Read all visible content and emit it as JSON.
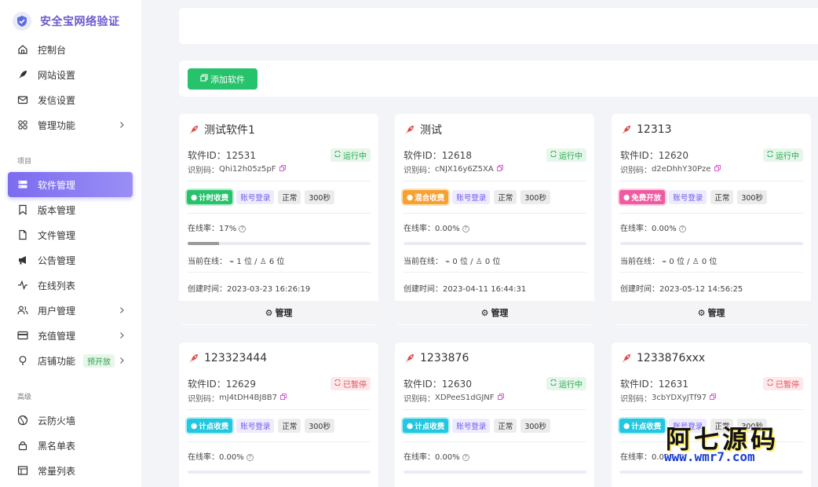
{
  "app": {
    "title": "安全宝网络验证"
  },
  "sidebar": {
    "items_top": [
      {
        "label": "控制台",
        "icon": "home-icon"
      },
      {
        "label": "网站设置",
        "icon": "rocket-icon"
      },
      {
        "label": "发信设置",
        "icon": "mail-icon"
      },
      {
        "label": "管理功能",
        "icon": "apps-icon"
      }
    ],
    "section_project": "项目",
    "items_project": [
      {
        "label": "软件管理",
        "icon": "server-icon"
      },
      {
        "label": "版本管理",
        "icon": "bookmark-icon"
      },
      {
        "label": "文件管理",
        "icon": "file-icon"
      },
      {
        "label": "公告管理",
        "icon": "megaphone-icon"
      },
      {
        "label": "在线列表",
        "icon": "activity-icon"
      },
      {
        "label": "用户管理",
        "icon": "users-icon"
      },
      {
        "label": "充值管理",
        "icon": "card-icon"
      },
      {
        "label": "店铺功能",
        "icon": "pin-icon",
        "badge": "预开放"
      }
    ],
    "section_advanced": "高级",
    "items_advanced": [
      {
        "label": "云防火墙",
        "icon": "globe-icon"
      },
      {
        "label": "黑名单表",
        "icon": "lock-icon"
      },
      {
        "label": "常量列表",
        "icon": "table-icon"
      }
    ]
  },
  "toolbar": {
    "add_label": "添加软件"
  },
  "labels": {
    "id_prefix": "软件ID：",
    "code_prefix": "识别码：",
    "online_rate_prefix": "在线率：",
    "current_prefix": "当前在线：",
    "created_prefix": "创建时间：",
    "manage": "管理",
    "login": "账号登录",
    "normal": "正常",
    "duration": "300秒",
    "running": "运行中",
    "paused": "已暂停"
  },
  "cards": [
    {
      "name": "测试软件1",
      "id": "12531",
      "code": "Qhi12h05z5pF",
      "status": "running",
      "type_label": "计时收费",
      "type": "time",
      "rate": "17%",
      "rate_value": 0.17,
      "online": "1 位 /",
      "total": "6 位",
      "created": "2023-03-23 16:26:19"
    },
    {
      "name": "测试",
      "id": "12618",
      "code": "cNJX16y6Z5XA",
      "status": "running",
      "type_label": "混合收费",
      "type": "mixed",
      "rate": "0.00%",
      "rate_value": 0,
      "online": "0 位 /",
      "total": "0 位",
      "created": "2023-04-11 16:44:31"
    },
    {
      "name": "12313",
      "id": "12620",
      "code": "d2eDhhY30Pze",
      "status": "running",
      "type_label": "免费开放",
      "type": "free",
      "rate": "0.00%",
      "rate_value": 0,
      "online": "0 位 /",
      "total": "0 位",
      "created": "2023-05-12 14:56:25"
    },
    {
      "name": "123323444",
      "id": "12629",
      "code": "mJ4tDH4BJ8B7",
      "status": "paused",
      "type_label": "计点收费",
      "type": "point",
      "rate": "0.00%",
      "rate_value": 0
    },
    {
      "name": "1233876",
      "id": "12630",
      "code": "XDPeeS1dGJNF",
      "status": "running",
      "type_label": "计点收费",
      "type": "point",
      "rate": "0.00%",
      "rate_value": 0
    },
    {
      "name": "1233876xxx",
      "id": "12631",
      "code": "3cbYDXyJTf97",
      "status": "paused",
      "type_label": "计点收费",
      "type": "point",
      "rate": "0.00%",
      "rate_value": 0
    }
  ],
  "watermark": {
    "text": "阿七源码",
    "url": "www.wmr7.com"
  },
  "colors": {
    "accent": "#7c6cf0",
    "success": "#27c26c",
    "danger": "#e0505a"
  }
}
